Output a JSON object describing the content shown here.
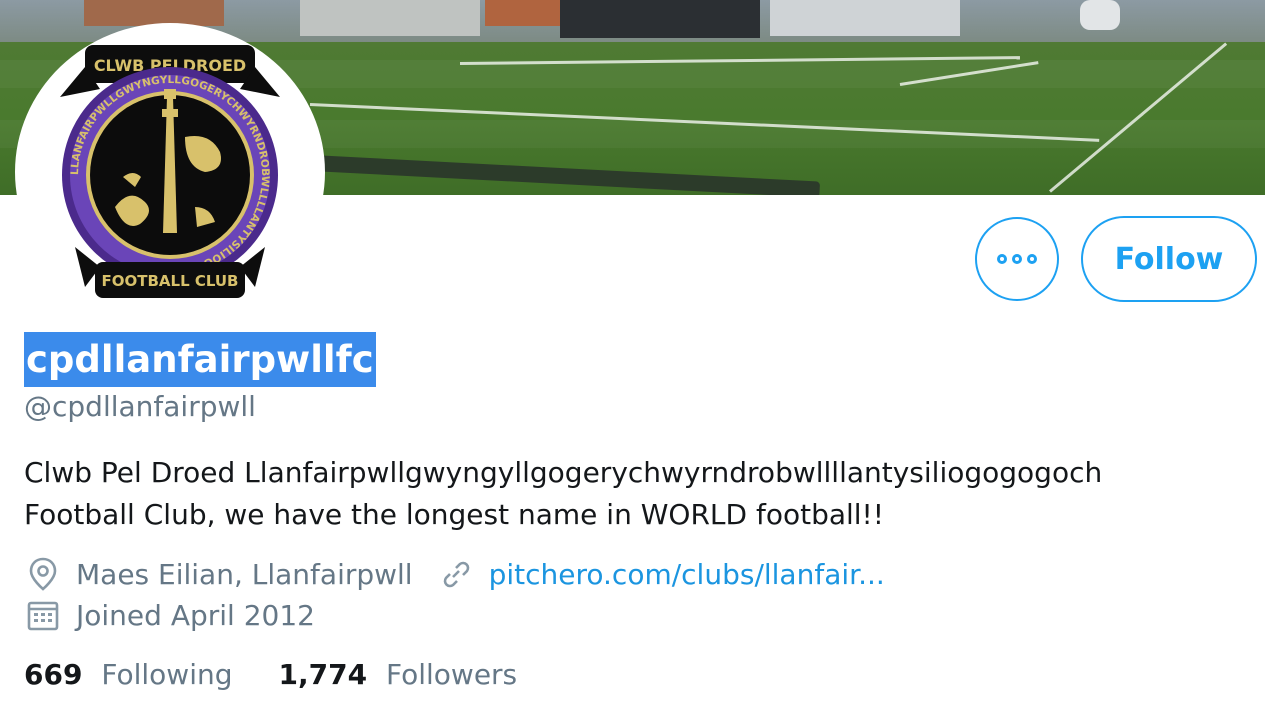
{
  "profile": {
    "display_name": "cpdllanfairpwllfc",
    "handle": "@cpdllanfairpwll",
    "bio_line1": "Clwb Pel Droed Llanfairpwllgwyngyllgogerychwyrndrobwllllantysiliogogogoch",
    "bio_line2": "Football Club, we have the longest name in WORLD football!!",
    "location": "Maes Eilian, Llanfairpwll",
    "website": "pitchero.com/clubs/llanfair...",
    "joined": "Joined April 2012"
  },
  "badge": {
    "top_text": "CLWB PELDROED",
    "bottom_text": "FOOTBALL CLUB",
    "ring_text": "LLANFAIRPWLLGWYNGYLLGOGERYCHWYRNDROBWLLLLANTYSILIOGOGOGOCH"
  },
  "actions": {
    "more_label": "More",
    "follow_label": "Follow"
  },
  "stats": {
    "following_count": "669",
    "following_label": "Following",
    "followers_count": "1,774",
    "followers_label": "Followers"
  },
  "colors": {
    "accent": "#1da1f2",
    "link": "#1b95e0",
    "selection": "#3b8beb",
    "secondary_text": "#657786"
  }
}
